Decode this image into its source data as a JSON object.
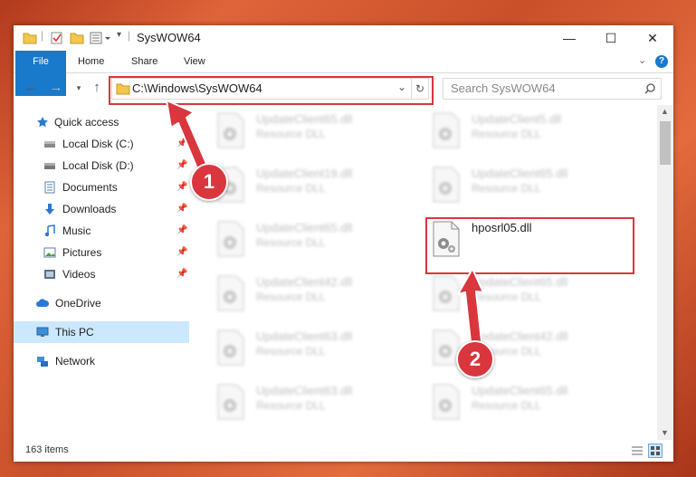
{
  "window": {
    "title": "SysWOW64",
    "controls": {
      "minimize": "—",
      "maximize": "☐",
      "close": "✕"
    }
  },
  "ribbon": {
    "tabs": [
      {
        "label": "File"
      },
      {
        "label": "Home"
      },
      {
        "label": "Share"
      },
      {
        "label": "View"
      }
    ]
  },
  "nav": {
    "address": "C:\\Windows\\SysWOW64",
    "search_placeholder": "Search SysWOW64"
  },
  "sidebar": {
    "items": [
      {
        "label": "Quick access",
        "icon": "star-icon"
      },
      {
        "label": "Local Disk (C:)",
        "icon": "drive-icon"
      },
      {
        "label": "Local Disk (D:)",
        "icon": "drive-icon"
      },
      {
        "label": "Documents",
        "icon": "documents-icon"
      },
      {
        "label": "Downloads",
        "icon": "download-icon"
      },
      {
        "label": "Music",
        "icon": "music-icon"
      },
      {
        "label": "Pictures",
        "icon": "pictures-icon"
      },
      {
        "label": "Videos",
        "icon": "videos-icon"
      },
      {
        "label": "OneDrive",
        "icon": "cloud-icon"
      },
      {
        "label": "This PC",
        "icon": "computer-icon"
      },
      {
        "label": "Network",
        "icon": "network-icon"
      }
    ]
  },
  "files": {
    "left": [
      {
        "name": "UpdateClient65.dll",
        "desc": "Resource DLL"
      },
      {
        "name": "UpdateClient19.dll",
        "desc": "Resource DLL"
      },
      {
        "name": "UpdateClient65.dll",
        "desc": "Resource DLL"
      },
      {
        "name": "UpdateClient42.dll",
        "desc": "Resource DLL"
      },
      {
        "name": "UpdateClient63.dll",
        "desc": "Resource DLL"
      },
      {
        "name": "UpdateClient63.dll",
        "desc": "Resource DLL"
      }
    ],
    "right": [
      {
        "name": "UpdateClient5.dll",
        "desc": "Resource DLL"
      },
      {
        "name": "UpdateClient65.dll",
        "desc": "Resource DLL"
      },
      {
        "name": "hposrl05.dll",
        "desc": ""
      },
      {
        "name": "UpdateClient65.dll",
        "desc": "Resource DLL"
      },
      {
        "name": "UpdateClient42.dll",
        "desc": "Resource DLL"
      },
      {
        "name": "UpdateClient65.dll",
        "desc": "Resource DLL"
      }
    ]
  },
  "status": {
    "item_count": "163 items"
  },
  "annotations": {
    "step1": "1",
    "step2": "2"
  },
  "colors": {
    "accent": "#1979ca",
    "annotation": "#d9363e",
    "selected": "#cce8ff"
  }
}
